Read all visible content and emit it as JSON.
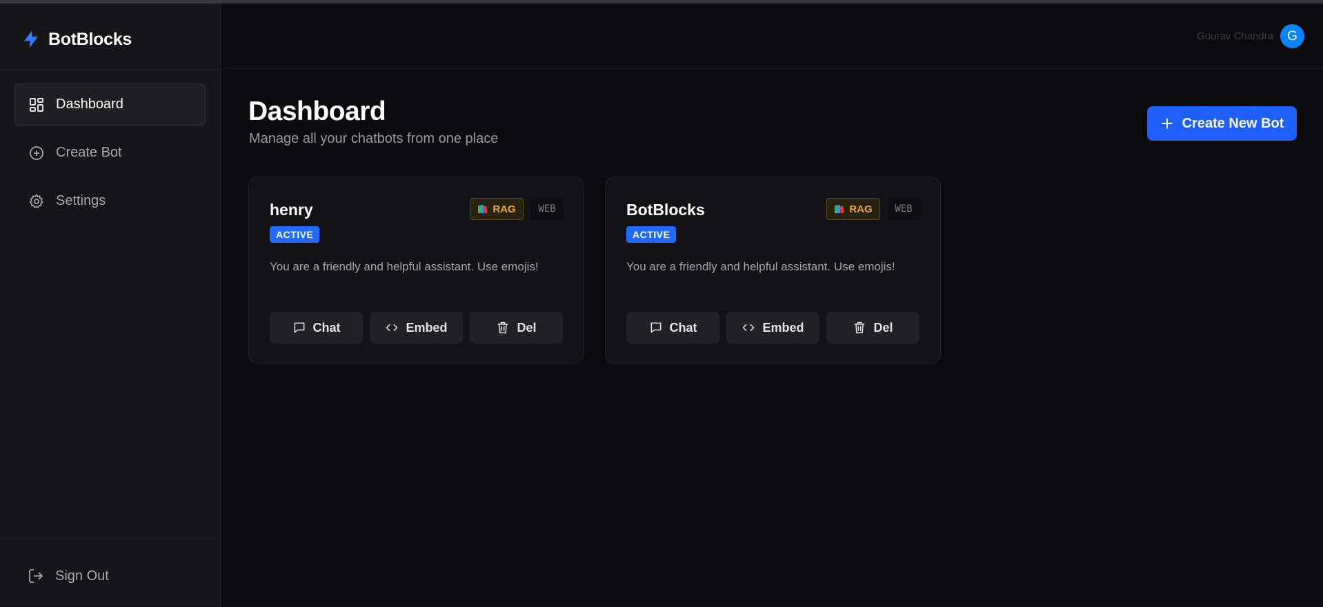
{
  "app": {
    "brand": "BotBlocks",
    "accent": "#1d5fff"
  },
  "sidebar": {
    "items": [
      {
        "label": "Dashboard",
        "icon": "dashboard-icon",
        "active": true
      },
      {
        "label": "Create Bot",
        "icon": "plus-circle-icon",
        "active": false
      },
      {
        "label": "Settings",
        "icon": "gear-icon",
        "active": false
      }
    ],
    "signout": "Sign Out"
  },
  "header": {
    "user_name": "Gourav Chandra",
    "avatar_initial": "G"
  },
  "main": {
    "title": "Dashboard",
    "subtitle": "Manage all your chatbots from one place",
    "create_button": "Create New Bot"
  },
  "bots": [
    {
      "name": "henry",
      "status": "ACTIVE",
      "tag_rag": "RAG",
      "tag_web": "WEB",
      "description": "You are a friendly and helpful assistant. Use emojis!",
      "actions": {
        "chat": "Chat",
        "embed": "Embed",
        "delete": "Del"
      }
    },
    {
      "name": "BotBlocks",
      "status": "ACTIVE",
      "tag_rag": "RAG",
      "tag_web": "WEB",
      "description": "You are a friendly and helpful assistant. Use emojis!",
      "actions": {
        "chat": "Chat",
        "embed": "Embed",
        "delete": "Del"
      }
    }
  ]
}
